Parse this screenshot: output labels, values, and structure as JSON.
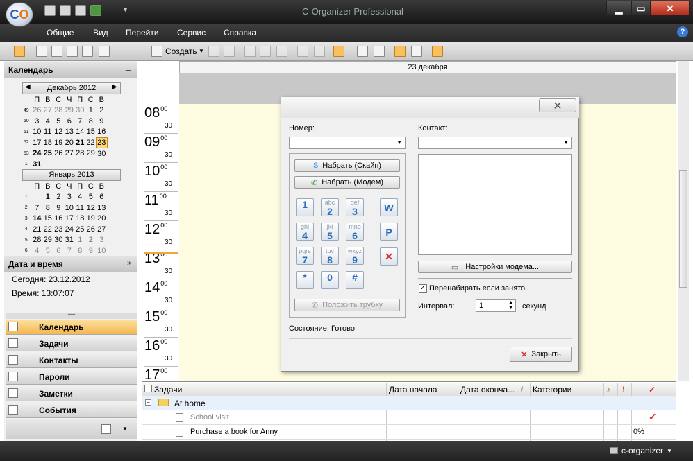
{
  "window": {
    "title": "C-Organizer Professional"
  },
  "menu": [
    "Общие",
    "Вид",
    "Перейти",
    "Сервис",
    "Справка"
  ],
  "toolbar": {
    "create_label": "Создать"
  },
  "left": {
    "calendar_title": "Календарь",
    "month1": "Декабрь 2012",
    "month2": "Январь 2013",
    "dow": [
      "П",
      "В",
      "С",
      "Ч",
      "П",
      "С",
      "В"
    ],
    "weeks1": [
      "49",
      "50",
      "51",
      "52",
      "53",
      "1"
    ],
    "weeks2": [
      "1",
      "2",
      "3",
      "4",
      "5",
      "6"
    ],
    "month1_rows": [
      [
        "26",
        "27",
        "28",
        "29",
        "30",
        "1",
        "2"
      ],
      [
        "3",
        "4",
        "5",
        "6",
        "7",
        "8",
        "9"
      ],
      [
        "10",
        "11",
        "12",
        "13",
        "14",
        "15",
        "16"
      ],
      [
        "17",
        "18",
        "19",
        "20",
        "21",
        "22",
        "23"
      ],
      [
        "24",
        "25",
        "26",
        "27",
        "28",
        "29",
        "30"
      ],
      [
        "31",
        "",
        "",
        "",
        "",
        "",
        ""
      ]
    ],
    "month2_rows": [
      [
        "",
        "1",
        "2",
        "3",
        "4",
        "5",
        "6"
      ],
      [
        "7",
        "8",
        "9",
        "10",
        "11",
        "12",
        "13"
      ],
      [
        "14",
        "15",
        "16",
        "17",
        "18",
        "19",
        "20"
      ],
      [
        "21",
        "22",
        "23",
        "24",
        "25",
        "26",
        "27"
      ],
      [
        "28",
        "29",
        "30",
        "31",
        "1",
        "2",
        "3"
      ],
      [
        "4",
        "5",
        "6",
        "7",
        "8",
        "9",
        "10"
      ]
    ],
    "datetime_title": "Дата и время",
    "today": "Сегодня: 23.12.2012",
    "time": "Время: 13:07:07",
    "nav": [
      "Календарь",
      "Задачи",
      "Контакты",
      "Пароли",
      "Заметки",
      "События"
    ]
  },
  "day_header": "23 декабря",
  "hours": [
    "08",
    "09",
    "10",
    "11",
    "12",
    "13",
    "14",
    "15",
    "16",
    "17"
  ],
  "hour_suffix": "00",
  "half_label": "30",
  "dialog": {
    "number_label": "Номер:",
    "contact_label": "Контакт:",
    "dial_skype": "Набрать (Скайп)",
    "dial_modem": "Набрать (Модем)",
    "keys": [
      {
        "d": "1",
        "s": ""
      },
      {
        "d": "2",
        "s": "abc"
      },
      {
        "d": "3",
        "s": "def"
      },
      {
        "d": "4",
        "s": "ghi"
      },
      {
        "d": "5",
        "s": "jkl"
      },
      {
        "d": "6",
        "s": "mno"
      },
      {
        "d": "7",
        "s": "pqrs"
      },
      {
        "d": "8",
        "s": "tuv"
      },
      {
        "d": "9",
        "s": "wxyz"
      },
      {
        "d": "*",
        "s": ""
      },
      {
        "d": "0",
        "s": ""
      },
      {
        "d": "#",
        "s": ""
      }
    ],
    "side_keys": [
      "W",
      "P",
      "✕"
    ],
    "hangup": "Положить трубку",
    "modem_settings": "Настройки модема...",
    "redial": "Перенабирать если занято",
    "interval_label": "Интервал:",
    "interval_value": "1",
    "interval_unit": "секунд",
    "status": "Состояние: Готово",
    "close": "Закрыть"
  },
  "tasks": {
    "headers": [
      "Задачи",
      "Дата начала",
      "Дата оконча...",
      "Категории"
    ],
    "group": "At home",
    "rows": [
      {
        "name": "School visit",
        "progress": "",
        "done": true
      },
      {
        "name": "Purchase a book for Anny",
        "progress": "0%",
        "done": false
      }
    ]
  },
  "statusbar": {
    "label": "c-organizer"
  }
}
